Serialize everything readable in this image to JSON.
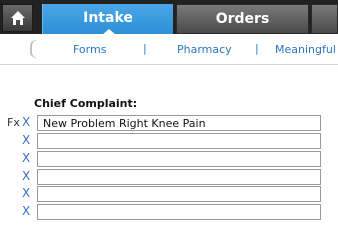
{
  "tabs": {
    "home_icon": "home-icon",
    "intake_label": "Intake",
    "orders_label": "Orders"
  },
  "subnav": {
    "links": [
      "Forms",
      "Pharmacy",
      "Meaningful"
    ],
    "separator": "|"
  },
  "complaint": {
    "label": "Chief Complaint:",
    "prefix": "Fx",
    "remove_glyph": "X",
    "rows": [
      {
        "value": "New Problem Right Knee Pain"
      },
      {
        "value": ""
      },
      {
        "value": ""
      },
      {
        "value": ""
      },
      {
        "value": ""
      },
      {
        "value": ""
      }
    ]
  },
  "colors": {
    "active_tab": "#2d8fd6",
    "inactive_tab": "#5a5a5a",
    "link": "#2a76c4"
  }
}
